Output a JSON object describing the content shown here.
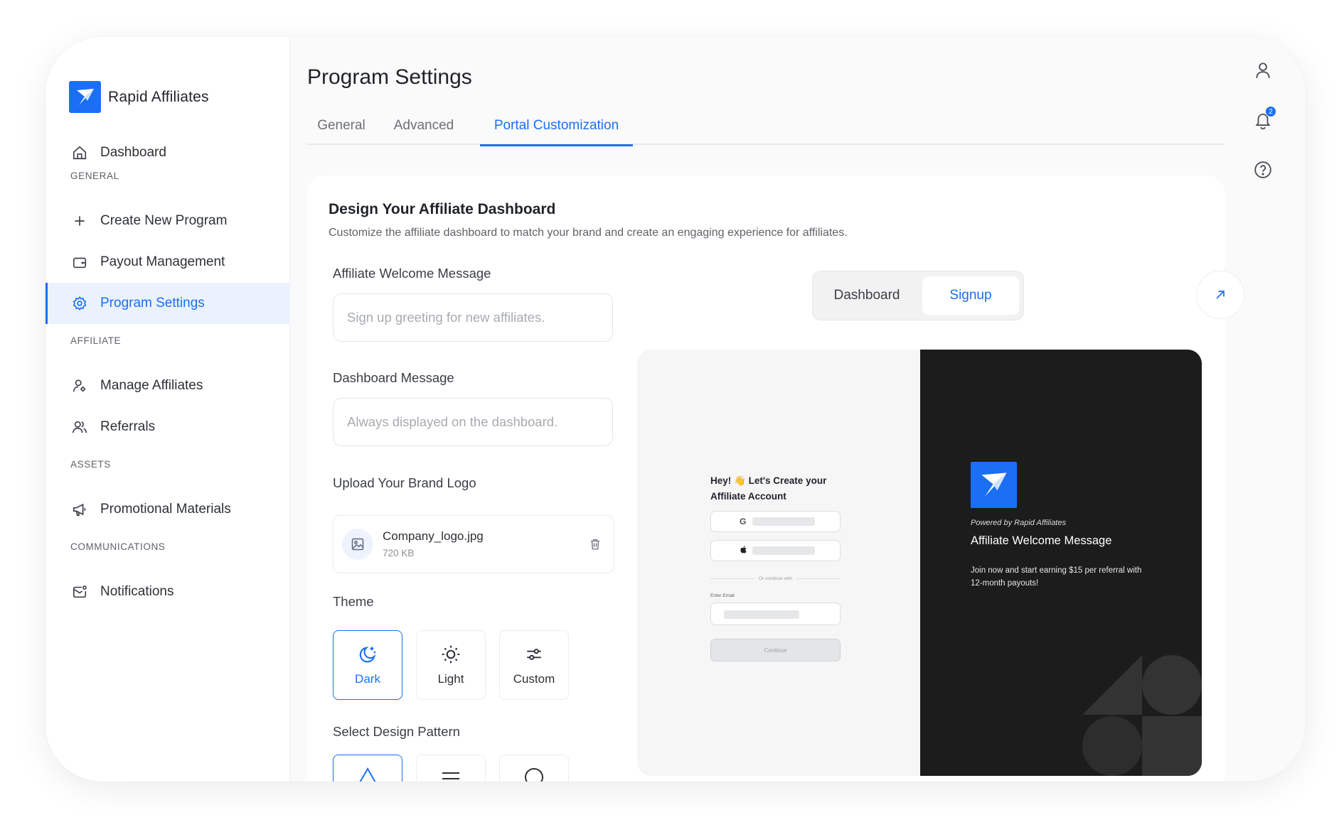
{
  "brand": {
    "name": "Rapid Affiliates"
  },
  "sidebar": {
    "dashboard": "Dashboard",
    "sections": {
      "general": "GENERAL",
      "affiliate": "AFFILIATE",
      "assets": "ASSETS",
      "communications": "COMMUNICATIONS"
    },
    "items": {
      "create_program": "Create New Program",
      "payout_management": "Payout Management",
      "program_settings": "Program Settings",
      "manage_affiliates": "Manage Affiliates",
      "referrals": "Referrals",
      "promotional_materials": "Promotional Materials",
      "notifications": "Notifications"
    }
  },
  "page": {
    "title": "Program Settings",
    "tabs": [
      "General",
      "Advanced",
      "Portal Customization"
    ],
    "active_tab": "Portal Customization"
  },
  "card": {
    "title": "Design Your Affiliate Dashboard",
    "description": "Customize the affiliate dashboard to match your brand and create an engaging experience for affiliates.",
    "welcome_label": "Affiliate Welcome Message",
    "welcome_placeholder": "Sign up greeting for new affiliates.",
    "dashboard_label": "Dashboard Message",
    "dashboard_placeholder": "Always displayed on the dashboard.",
    "logo_label": "Upload Your Brand Logo",
    "logo_file": {
      "name": "Company_logo.jpg",
      "size": "720 KB"
    },
    "theme_label": "Theme",
    "themes": [
      "Dark",
      "Light",
      "Custom"
    ],
    "selected_theme": "Dark",
    "pattern_label": "Select Design Pattern"
  },
  "preview": {
    "toggle": [
      "Dashboard",
      "Signup"
    ],
    "active_toggle": "Signup",
    "heading": "Hey! 👋 Let's Create your Affiliate Account",
    "google_glyph": "G",
    "or_continue": "Or continue with",
    "email_label": "Enter Email",
    "continue_label": "Continue",
    "powered_by": "Powered by Rapid Affiliates",
    "welcome_message": "Affiliate Welcome Message",
    "welcome_description": "Join now and start earning $15 per referral with 12-month payouts!"
  },
  "rail": {
    "notification_count": "2"
  },
  "colors": {
    "accent": "#1a6ff5",
    "preview_dark": "#1c1c1c"
  }
}
